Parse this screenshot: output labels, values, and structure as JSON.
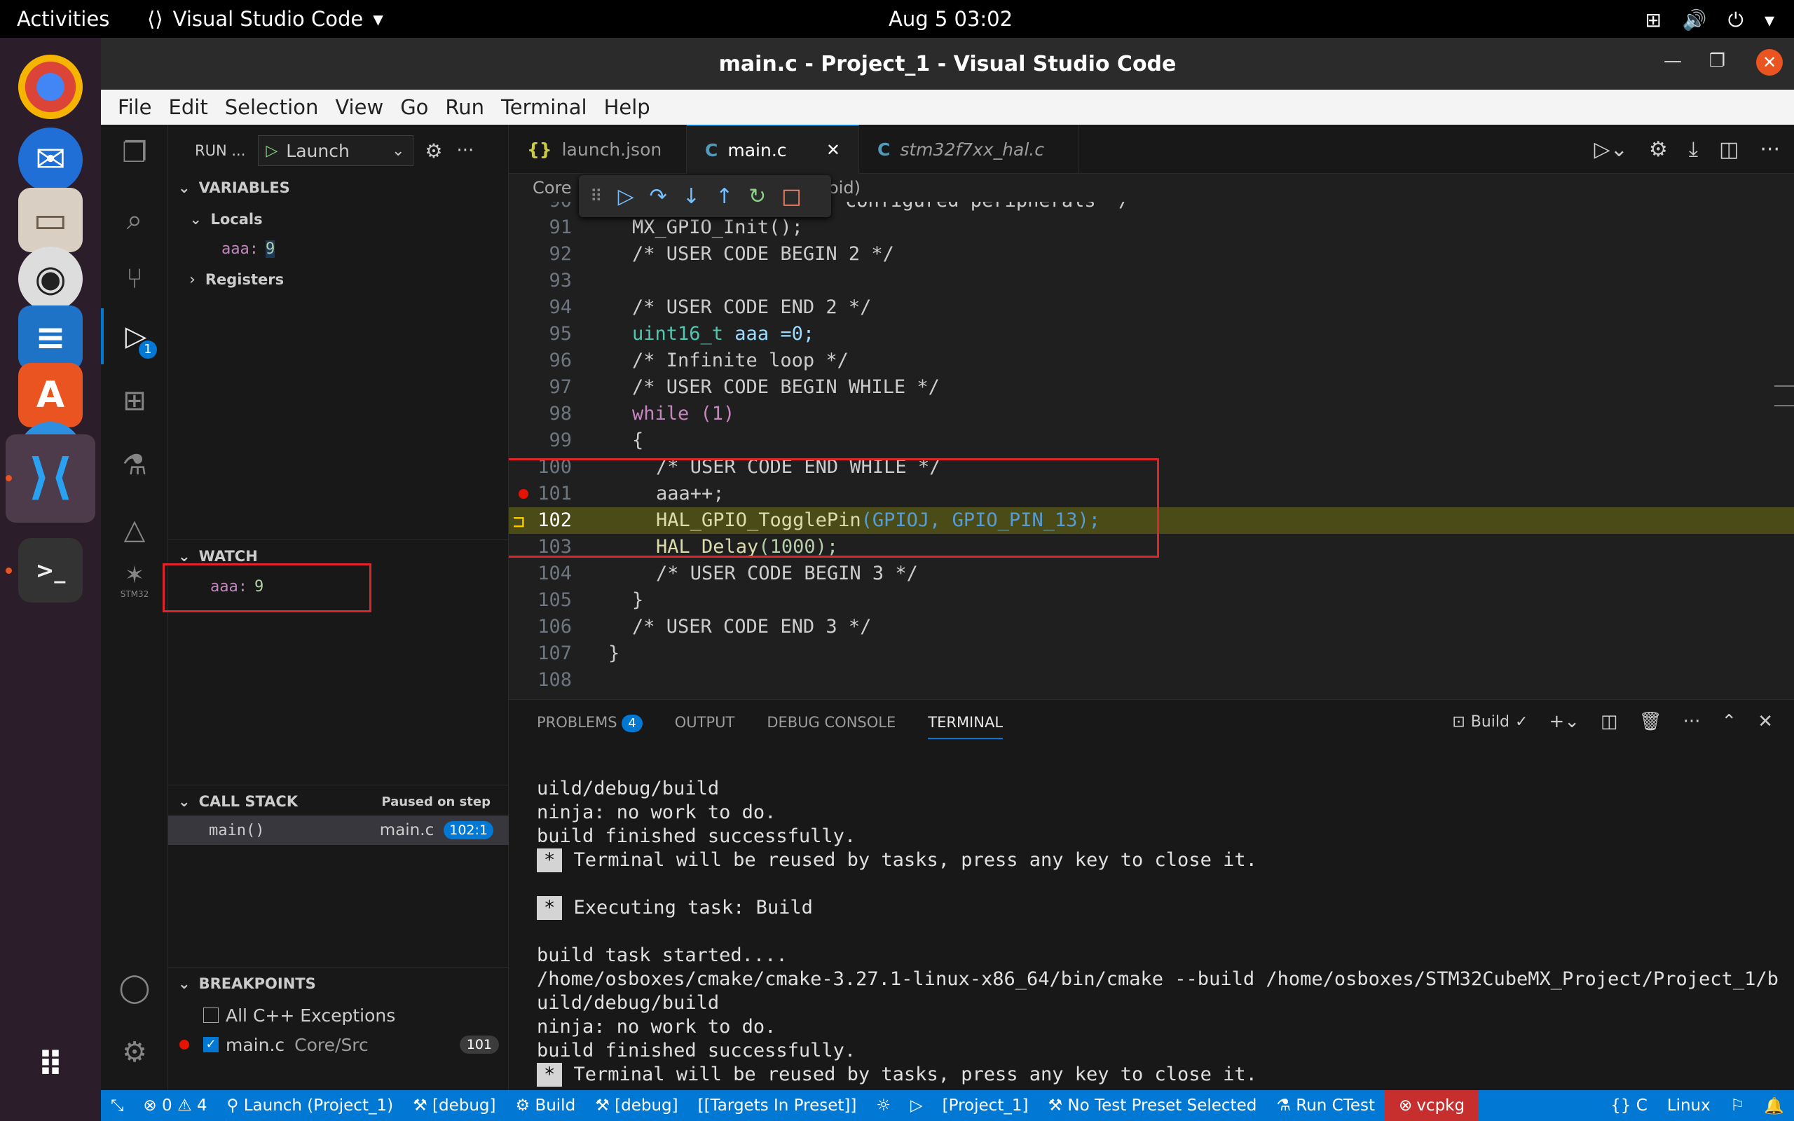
{
  "os_topbar": {
    "activities": "Activities",
    "app_name": "Visual Studio Code",
    "clock": "Aug 5  03:02"
  },
  "window": {
    "title": "main.c - Project_1 - Visual Studio Code"
  },
  "menu": [
    "File",
    "Edit",
    "Selection",
    "View",
    "Go",
    "Run",
    "Terminal",
    "Help"
  ],
  "activity_bar": {
    "run_badge": "1",
    "stm32_label": "STM32"
  },
  "sidebar": {
    "run_label": "RUN ...",
    "launch_config": "Launch",
    "variables_header": "VARIABLES",
    "locals_label": "Locals",
    "local_var_name": "aaa:",
    "local_var_value": "9",
    "registers_label": "Registers",
    "watch_header": "WATCH",
    "watch_name": "aaa:",
    "watch_value": "9",
    "callstack_header": "CALL STACK",
    "callstack_status": "Paused on step",
    "frame_name": "main()",
    "frame_file": "main.c",
    "frame_pos": "102:1",
    "breakpoints_header": "BREAKPOINTS",
    "bp_exceptions": "All C++ Exceptions",
    "bp_file": "main.c",
    "bp_path": "Core/Src",
    "bp_line": "101"
  },
  "tabs": [
    {
      "label": "launch.json",
      "icon": "{}"
    },
    {
      "label": "main.c",
      "icon": "C"
    },
    {
      "label": "stm32f7xx_hal.c",
      "icon": "C"
    }
  ],
  "breadcrumb": "Core",
  "breadcrumb_tail": "oid)",
  "code": {
    "partial_top": "configured peripherals */",
    "line_numbers": [
      "90",
      "91",
      "92",
      "93",
      "94",
      "95",
      "96",
      "97",
      "98",
      "99",
      "100",
      "101",
      "102",
      "103",
      "104",
      "105",
      "106",
      "107",
      "108"
    ],
    "l91": "MX_GPIO_Init();",
    "l92": "/* USER CODE BEGIN 2 */",
    "l94": "/* USER CODE END 2 */",
    "l95_type": "uint16_t",
    "l95_rest": " aaa =0;",
    "l96": "/* Infinite loop */",
    "l97": "/* USER CODE BEGIN WHILE */",
    "l98_kw": "while",
    "l98_rest": " (1)",
    "l99": "{",
    "l100": "/* USER CODE END WHILE */",
    "l101": "aaa++;",
    "l102_fn": "HAL_GPIO_TogglePin",
    "l102_args": "(GPIOJ, GPIO_PIN_13);",
    "l103_fn": "HAL_Delay",
    "l103_args": "(1000);",
    "l104": "/* USER CODE BEGIN 3 */",
    "l105": "}",
    "l106": "/* USER CODE END 3 */",
    "l107": "}"
  },
  "panel": {
    "tabs": [
      "PROBLEMS",
      "OUTPUT",
      "DEBUG CONSOLE",
      "TERMINAL"
    ],
    "problems_count": "4",
    "task_name": "Build",
    "terminal_lines": [
      "uild/debug/build",
      "ninja: no work to do.",
      "build finished successfully.",
      " Terminal will be reused by tasks, press any key to close it.",
      "",
      " Executing task: Build",
      "",
      "build task started....",
      "/home/osboxes/cmake/cmake-3.27.1-linux-x86_64/bin/cmake --build /home/osboxes/STM32CubeMX_Project/Project_1/b",
      "uild/debug/build",
      "ninja: no work to do.",
      "build finished successfully.",
      " Terminal will be reused by tasks, press any key to close it."
    ]
  },
  "statusbar": {
    "errors": "0",
    "warnings": "4",
    "launch": "Launch (Project_1)",
    "debug1": "[debug]",
    "build": "Build",
    "debug2": "[debug]",
    "targets": "[[Targets In Preset]]",
    "project": "[Project_1]",
    "test_preset": "No Test Preset Selected",
    "ctest": "Run CTest",
    "vcpkg": "vcpkg",
    "lang": "C",
    "os": "Linux"
  },
  "colors": {
    "accent": "#0078d4",
    "highlight_box": "#e0242b",
    "current_line": "#4b4b18"
  }
}
